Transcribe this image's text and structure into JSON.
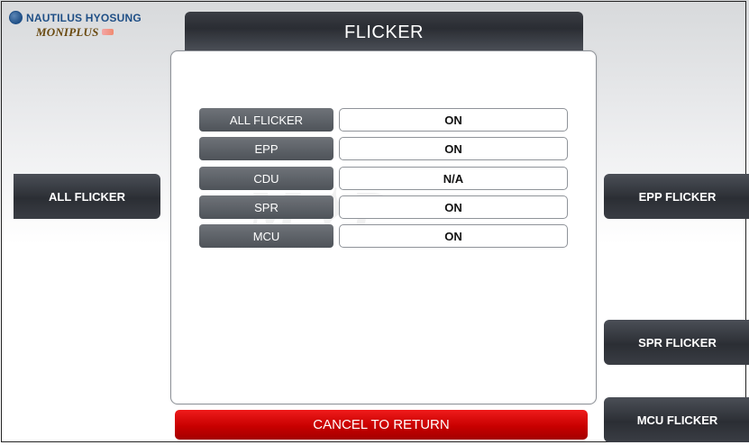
{
  "logo": {
    "brand": "NAUTILUS HYOSUNG",
    "product": "MONIPLUS"
  },
  "header": {
    "title": "FLICKER"
  },
  "status": [
    {
      "label": "ALL FLICKER",
      "value": "ON"
    },
    {
      "label": "EPP",
      "value": "ON"
    },
    {
      "label": "CDU",
      "value": "N/A"
    },
    {
      "label": "SPR",
      "value": "ON"
    },
    {
      "label": "MCU",
      "value": "ON"
    }
  ],
  "side_buttons": {
    "left": [
      {
        "label": "ALL FLICKER"
      }
    ],
    "right": [
      {
        "label": "EPP FLICKER"
      },
      {
        "label": "SPR FLICKER"
      },
      {
        "label": "MCU FLICKER"
      }
    ]
  },
  "footer": {
    "cancel_label": "CANCEL TO RETURN"
  },
  "colors": {
    "title_bar": "#2a2d33",
    "label_bg": "#55595f",
    "cancel": "#d10000"
  }
}
